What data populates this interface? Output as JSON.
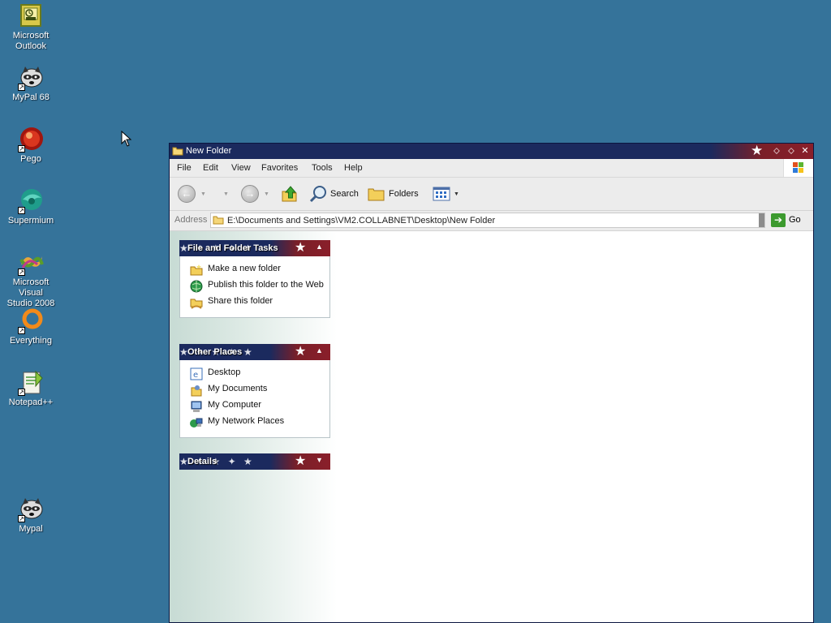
{
  "desktop": {
    "icons": [
      {
        "label": "Microsoft\nOutlook",
        "icon": "outlook-icon"
      },
      {
        "label": "MyPal 68",
        "icon": "raccoon-icon"
      },
      {
        "label": "Pego",
        "icon": "pego-icon"
      },
      {
        "label": "Supermium",
        "icon": "supermium-icon"
      },
      {
        "label": "Microsoft Visual\nStudio 2008",
        "icon": "visual-studio-icon"
      },
      {
        "label": "Everything",
        "icon": "everything-icon"
      },
      {
        "label": "Notepad++",
        "icon": "notepad-icon"
      },
      {
        "label": "Mypal",
        "icon": "raccoon-icon"
      }
    ],
    "background": "#35739a"
  },
  "window": {
    "title": "New Folder",
    "menu": [
      "File",
      "Edit",
      "View",
      "Favorites",
      "Tools",
      "Help"
    ],
    "toolbar": {
      "search_label": "Search",
      "folders_label": "Folders"
    },
    "address": {
      "label": "Address",
      "value": "E:\\Documents and Settings\\VM2.COLLABNET\\Desktop\\New Folder",
      "go_label": "Go"
    },
    "panes": {
      "file_tasks": {
        "title": "File and Folder Tasks",
        "items": [
          "Make a new folder",
          "Publish this folder to the Web",
          "Share this folder"
        ]
      },
      "other_places": {
        "title": "Other Places",
        "items": [
          "Desktop",
          "My Documents",
          "My Computer",
          "My Network Places"
        ]
      },
      "details": {
        "title": "Details"
      }
    },
    "colors": {
      "titlebar_navy": "#1b2a5e",
      "titlebar_red": "#8a1f2a",
      "go_green": "#3c9a2e"
    }
  }
}
